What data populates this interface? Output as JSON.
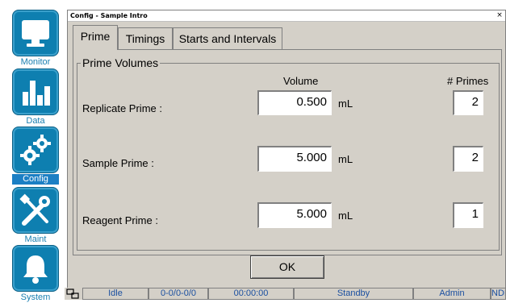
{
  "nav": {
    "items": [
      {
        "label": "Monitor",
        "icon": "monitor-icon"
      },
      {
        "label": "Data",
        "icon": "bar-chart-icon"
      },
      {
        "label": "Config",
        "icon": "gears-icon",
        "active": true
      },
      {
        "label": "Maint",
        "icon": "tools-icon"
      },
      {
        "label": "System",
        "icon": "bell-icon"
      }
    ]
  },
  "window": {
    "title": "Config - Sample Intro",
    "close": "×"
  },
  "tabs": [
    {
      "label": "Prime",
      "active": true
    },
    {
      "label": "Timings"
    },
    {
      "label": "Starts and Intervals"
    }
  ],
  "group": {
    "legend": "Prime Volumes",
    "col_volume": "Volume",
    "col_primes": "# Primes",
    "rows": [
      {
        "label": "Replicate Prime :",
        "volume": "0.500",
        "unit": "mL",
        "primes": "2"
      },
      {
        "label": "Sample Prime :",
        "volume": "5.000",
        "unit": "mL",
        "primes": "2"
      },
      {
        "label": "Reagent Prime :",
        "volume": "5.000",
        "unit": "mL",
        "primes": "1"
      }
    ]
  },
  "ok_label": "OK",
  "status": {
    "state": "Idle",
    "counter": "0-0/0-0/0",
    "time": "00:00:00",
    "mode": "Standby",
    "user": "Admin",
    "extra": "NDIR"
  },
  "colors": {
    "accent": "#0e7fb0",
    "window_bg": "#d4d0c8"
  }
}
